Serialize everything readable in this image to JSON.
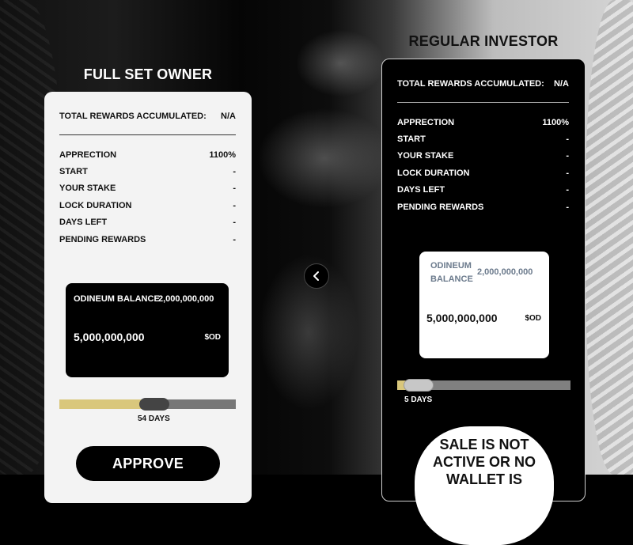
{
  "full_set_owner": {
    "title": "FULL SET OWNER",
    "total_rewards": {
      "label": "TOTAL REWARDS ACCUMULATED:",
      "value": "N/A"
    },
    "stats": [
      {
        "label": "APPRECTION",
        "value": "1100%"
      },
      {
        "label": "START",
        "value": "-"
      },
      {
        "label": "YOUR STAKE",
        "value": "-"
      },
      {
        "label": "LOCK DURATION",
        "value": "-"
      },
      {
        "label": "DAYS LEFT",
        "value": "-"
      },
      {
        "label": "PENDING REWARDS",
        "value": "-"
      }
    ],
    "balance": {
      "label": "ODINEUM BALANCE",
      "value": "2,000,000,000",
      "amount": "5,000,000,000",
      "unit": "$OD"
    },
    "slider": {
      "label": "54 DAYS",
      "fraction": 0.54
    },
    "approve_label": "APPROVE"
  },
  "regular_investor": {
    "title": "REGULAR INVESTOR",
    "total_rewards": {
      "label": "TOTAL REWARDS ACCUMULATED:",
      "value": "N/A"
    },
    "stats": [
      {
        "label": "APPRECTION",
        "value": "1100%"
      },
      {
        "label": "START",
        "value": "-"
      },
      {
        "label": "YOUR STAKE",
        "value": "-"
      },
      {
        "label": "LOCK DURATION",
        "value": "-"
      },
      {
        "label": "DAYS LEFT",
        "value": "-"
      },
      {
        "label": "PENDING REWARDS",
        "value": "-"
      }
    ],
    "balance": {
      "label_line1": "ODINEUM",
      "label_line2": "BALANCE",
      "value": "2,000,000,000",
      "amount": "5,000,000,000",
      "unit": "$OD"
    },
    "slider": {
      "label": "5 DAYS",
      "fraction": 0.05
    },
    "sale_message": "SALE IS NOT ACTIVE OR NO WALLET IS"
  },
  "carousel": {
    "prev_icon": "chevron-left-icon"
  }
}
